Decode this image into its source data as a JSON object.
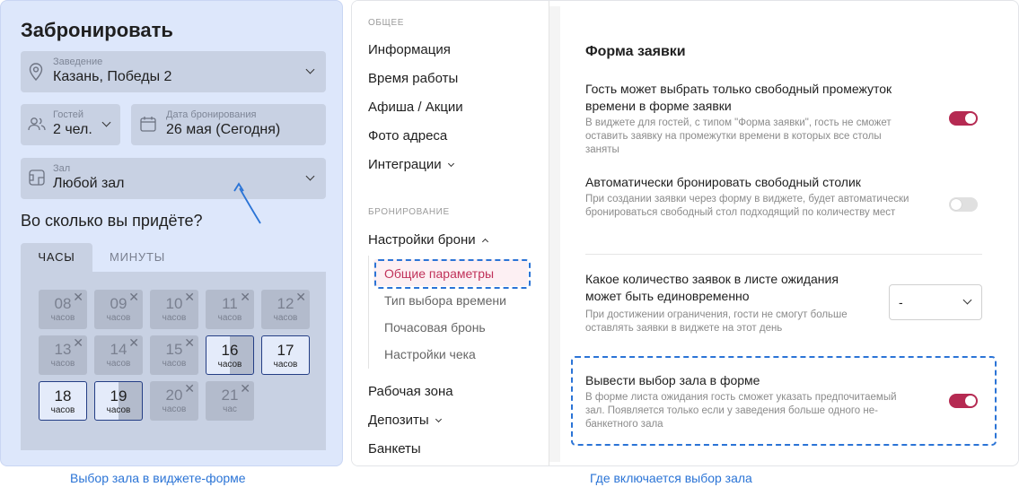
{
  "widget": {
    "title": "Забронировать",
    "venue": {
      "label": "Заведение",
      "value": "Казань, Победы 2"
    },
    "guests": {
      "label": "Гостей",
      "value": "2 чел."
    },
    "date": {
      "label": "Дата бронирования",
      "value": "26 мая (Сегодня)"
    },
    "hall": {
      "label": "Зал",
      "value": "Любой зал"
    },
    "question": "Во сколько вы придёте?",
    "tabs": {
      "hours": "ЧАСЫ",
      "minutes": "МИНУТЫ"
    },
    "hours": [
      {
        "num": "08",
        "unit": "часов",
        "state": "disabled"
      },
      {
        "num": "09",
        "unit": "часов",
        "state": "disabled"
      },
      {
        "num": "10",
        "unit": "часов",
        "state": "disabled"
      },
      {
        "num": "11",
        "unit": "часов",
        "state": "disabled"
      },
      {
        "num": "12",
        "unit": "часов",
        "state": "disabled"
      },
      {
        "num": "13",
        "unit": "часов",
        "state": "disabled"
      },
      {
        "num": "14",
        "unit": "часов",
        "state": "disabled"
      },
      {
        "num": "15",
        "unit": "часов",
        "state": "disabled"
      },
      {
        "num": "16",
        "unit": "часов",
        "state": "partial"
      },
      {
        "num": "17",
        "unit": "часов",
        "state": "available"
      },
      {
        "num": "18",
        "unit": "часов",
        "state": "available"
      },
      {
        "num": "19",
        "unit": "часов",
        "state": "partial"
      },
      {
        "num": "20",
        "unit": "часов",
        "state": "disabled"
      },
      {
        "num": "21",
        "unit": "час",
        "state": "disabled"
      }
    ],
    "close_glyph": "✕"
  },
  "captions": {
    "left": "Выбор зала в виджете-форме",
    "right": "Где включается выбор зала"
  },
  "sidebar": {
    "section_general": "ОБЩЕЕ",
    "items_general": [
      "Информация",
      "Время работы",
      "Афиша / Акции",
      "Фото адреса",
      "Интеграции"
    ],
    "section_booking": "БРОНИРОВАНИЕ",
    "booking_settings": "Настройки брони",
    "sub_items": [
      "Общие параметры",
      "Тип выбора времени",
      "Почасовая бронь",
      "Настройки чека"
    ],
    "items_after": [
      "Рабочая зона",
      "Депозиты",
      "Банкеты"
    ]
  },
  "settings": {
    "title": "Форма заявки",
    "items": [
      {
        "title": "Гость может выбрать только свободный промежуток времени в форме заявки",
        "desc": "В виджете для гостей, с типом \"Форма заявки\", гость не сможет оставить заявку на промежутки времени в которых все столы заняты",
        "enabled": true
      },
      {
        "title": "Автоматически бронировать свободный столик",
        "desc": "При создании заявки через форму в виджете, будет автоматически бронироваться свободный стол подходящий по количеству мест",
        "enabled": false
      },
      {
        "title": "Какое количество заявок в листе ожидания может быть единовременно",
        "desc": "При достижении ограничения, гости не смогут больше оставлять заявки в виджете на этот день",
        "select_value": "-"
      },
      {
        "title": "Вывести выбор зала в форме",
        "desc": "В форме листа ожидания гость сможет указать предпочитаемый зал. Появляется только если у заведения больше одного не-банкетного зала",
        "enabled": true
      }
    ]
  },
  "colors": {
    "accent": "#b52a52",
    "annotation": "#2b74d6",
    "widget_bg": "#dde7fb"
  },
  "icons": [
    "location-pin-icon",
    "people-icon",
    "calendar-icon",
    "hall-icon",
    "chevron-down-icon",
    "close-icon",
    "pointer-arrow-icon"
  ]
}
